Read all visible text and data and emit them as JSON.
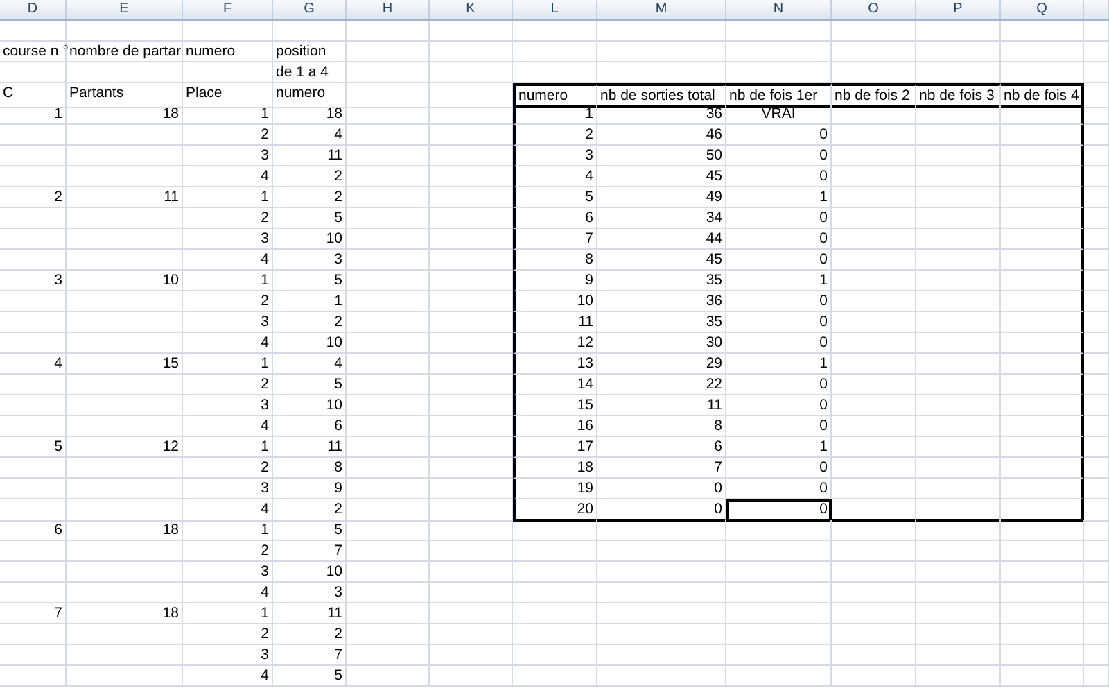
{
  "column_headers": [
    "D",
    "E",
    "F",
    "G",
    "H",
    "K",
    "L",
    "M",
    "N",
    "O",
    "P",
    "Q"
  ],
  "left_block": {
    "headings": {
      "course": "course n °",
      "partants": "nombre de partar",
      "numero": "numero",
      "position": [
        "position",
        "de 1 a 4"
      ]
    },
    "subheadings": [
      "C",
      "Partants",
      "Place",
      "numero"
    ],
    "courses": [
      {
        "course": "1",
        "partants": "18",
        "places": [
          {
            "place": "1",
            "numero": "18"
          },
          {
            "place": "2",
            "numero": "4"
          },
          {
            "place": "3",
            "numero": "11"
          },
          {
            "place": "4",
            "numero": "2"
          }
        ]
      },
      {
        "course": "2",
        "partants": "11",
        "places": [
          {
            "place": "1",
            "numero": "2"
          },
          {
            "place": "2",
            "numero": "5"
          },
          {
            "place": "3",
            "numero": "10"
          },
          {
            "place": "4",
            "numero": "3"
          }
        ]
      },
      {
        "course": "3",
        "partants": "10",
        "places": [
          {
            "place": "1",
            "numero": "5"
          },
          {
            "place": "2",
            "numero": "1"
          },
          {
            "place": "3",
            "numero": "2"
          },
          {
            "place": "4",
            "numero": "10"
          }
        ]
      },
      {
        "course": "4",
        "partants": "15",
        "places": [
          {
            "place": "1",
            "numero": "4"
          },
          {
            "place": "2",
            "numero": "5"
          },
          {
            "place": "3",
            "numero": "10"
          },
          {
            "place": "4",
            "numero": "6"
          }
        ]
      },
      {
        "course": "5",
        "partants": "12",
        "places": [
          {
            "place": "1",
            "numero": "11"
          },
          {
            "place": "2",
            "numero": "8"
          },
          {
            "place": "3",
            "numero": "9"
          },
          {
            "place": "4",
            "numero": "2"
          }
        ]
      },
      {
        "course": "6",
        "partants": "18",
        "places": [
          {
            "place": "1",
            "numero": "5"
          },
          {
            "place": "2",
            "numero": "7"
          },
          {
            "place": "3",
            "numero": "10"
          },
          {
            "place": "4",
            "numero": "3"
          }
        ]
      },
      {
        "course": "7",
        "partants": "18",
        "places": [
          {
            "place": "1",
            "numero": "11"
          },
          {
            "place": "2",
            "numero": "2"
          },
          {
            "place": "3",
            "numero": "7"
          },
          {
            "place": "4",
            "numero": "5"
          }
        ]
      }
    ]
  },
  "right_table": {
    "columns": [
      "numero",
      "nb de sorties total",
      "nb de fois 1er",
      "nb de fois 2",
      "nb de fois 3",
      "nb de fois 4"
    ],
    "rows": [
      {
        "numero": "1",
        "sorties": "36",
        "fois_1er": "VRAI",
        "kind": "boolean",
        "selected": false
      },
      {
        "numero": "2",
        "sorties": "46",
        "fois_1er": "0",
        "kind": "number",
        "selected": false
      },
      {
        "numero": "3",
        "sorties": "50",
        "fois_1er": "0",
        "kind": "number",
        "selected": false
      },
      {
        "numero": "4",
        "sorties": "45",
        "fois_1er": "0",
        "kind": "number",
        "selected": false
      },
      {
        "numero": "5",
        "sorties": "49",
        "fois_1er": "1",
        "kind": "number",
        "selected": false
      },
      {
        "numero": "6",
        "sorties": "34",
        "fois_1er": "0",
        "kind": "number",
        "selected": false
      },
      {
        "numero": "7",
        "sorties": "44",
        "fois_1er": "0",
        "kind": "number",
        "selected": false
      },
      {
        "numero": "8",
        "sorties": "45",
        "fois_1er": "0",
        "kind": "number",
        "selected": false
      },
      {
        "numero": "9",
        "sorties": "35",
        "fois_1er": "1",
        "kind": "number",
        "selected": false
      },
      {
        "numero": "10",
        "sorties": "36",
        "fois_1er": "0",
        "kind": "number",
        "selected": false
      },
      {
        "numero": "11",
        "sorties": "35",
        "fois_1er": "0",
        "kind": "number",
        "selected": false
      },
      {
        "numero": "12",
        "sorties": "30",
        "fois_1er": "0",
        "kind": "number",
        "selected": false
      },
      {
        "numero": "13",
        "sorties": "29",
        "fois_1er": "1",
        "kind": "number",
        "selected": false
      },
      {
        "numero": "14",
        "sorties": "22",
        "fois_1er": "0",
        "kind": "number",
        "selected": false
      },
      {
        "numero": "15",
        "sorties": "11",
        "fois_1er": "0",
        "kind": "number",
        "selected": false
      },
      {
        "numero": "16",
        "sorties": "8",
        "fois_1er": "0",
        "kind": "number",
        "selected": false
      },
      {
        "numero": "17",
        "sorties": "6",
        "fois_1er": "1",
        "kind": "number",
        "selected": false
      },
      {
        "numero": "18",
        "sorties": "7",
        "fois_1er": "0",
        "kind": "number",
        "selected": false
      },
      {
        "numero": "19",
        "sorties": "0",
        "fois_1er": "0",
        "kind": "number",
        "selected": false
      },
      {
        "numero": "20",
        "sorties": "0",
        "fois_1er": "0",
        "kind": "number",
        "selected": true
      }
    ]
  }
}
